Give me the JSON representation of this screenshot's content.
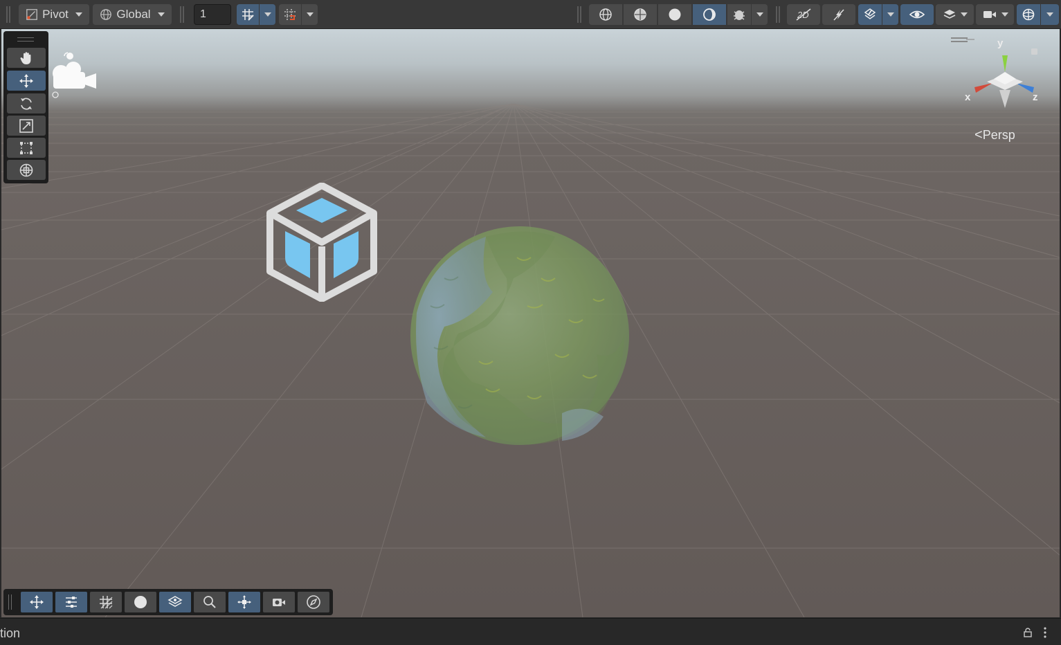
{
  "toolbar": {
    "pivot_label": "Pivot",
    "global_label": "Global",
    "grid_snap_value": "1",
    "colors": {
      "accent": "#46607c",
      "button": "#4a4a4a",
      "toolbar_bg": "#383838"
    },
    "left_icons": [
      "pivot-icon",
      "global-icon",
      "grid-snap-icon",
      "snap-increment-icon"
    ],
    "right_icons": [
      "wireframe-icon",
      "shaded-wireframe-icon",
      "shaded-icon",
      "unlit-icon",
      "debug-draw-mode-icon",
      "2d-toggle-icon",
      "lighting-toggle-icon",
      "audio-effects-icon",
      "scene-visibility-icon",
      "layers-icon",
      "camera-icon",
      "gizmos-icon"
    ]
  },
  "tools": {
    "items": [
      {
        "name": "hand-tool",
        "icon": "hand-icon",
        "active": false
      },
      {
        "name": "move-tool",
        "icon": "move-icon",
        "active": true
      },
      {
        "name": "rotate-tool",
        "icon": "rotate-icon",
        "active": false
      },
      {
        "name": "scale-tool",
        "icon": "scale-icon",
        "active": false
      },
      {
        "name": "rect-tool",
        "icon": "rect-icon",
        "active": false
      },
      {
        "name": "transform-tool",
        "icon": "transform-icon",
        "active": false
      }
    ]
  },
  "gizmo": {
    "y_label": "y",
    "x_label": "x",
    "z_label": "z",
    "projection_label": "Persp"
  },
  "overlays": {
    "items": [
      {
        "name": "move-overlay",
        "icon": "move-icon",
        "active": true
      },
      {
        "name": "settings-overlay",
        "icon": "sliders-icon",
        "active": true
      },
      {
        "name": "grid-overlay",
        "icon": "grid-icon",
        "active": false
      },
      {
        "name": "shaded-overlay",
        "icon": "sphere-icon",
        "active": false
      },
      {
        "name": "layers-overlay",
        "icon": "layers-icon",
        "active": true
      },
      {
        "name": "search-overlay",
        "icon": "search-icon",
        "active": false
      },
      {
        "name": "pivot-overlay",
        "icon": "pivot-icon",
        "active": true
      },
      {
        "name": "camera-overlay",
        "icon": "camera-icon",
        "active": false
      },
      {
        "name": "navigate-overlay",
        "icon": "compass-icon",
        "active": false
      }
    ]
  },
  "status": {
    "text": "tion"
  }
}
